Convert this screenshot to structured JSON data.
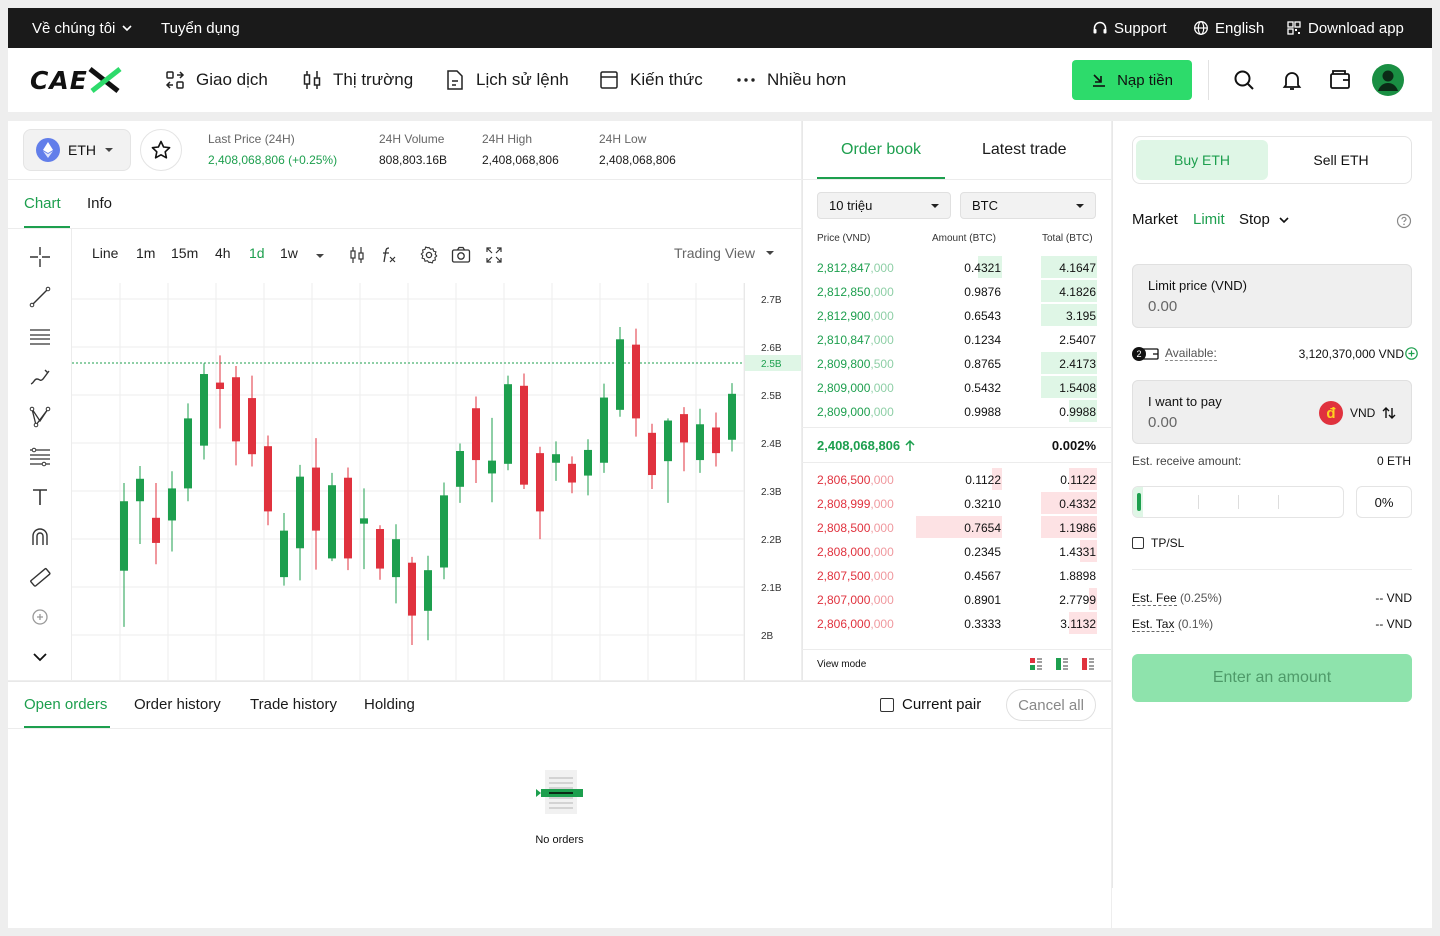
{
  "topbar": {
    "about": "Về chúng tôi",
    "careers": "Tuyển dụng",
    "support": "Support",
    "language": "English",
    "download": "Download app"
  },
  "nav": {
    "logo": "CAEX",
    "items": [
      "Giao dịch",
      "Thị trường",
      "Lịch sử lệnh",
      "Kiến thức",
      "Nhiều hơn"
    ],
    "deposit": "Nạp tiền"
  },
  "market": {
    "pair": "ETH",
    "last_price_label": "Last Price (24H)",
    "last_price": "2,408,068,806 (+0.25%)",
    "volume_label": "24H Volume",
    "volume": "808,803.16B",
    "high_label": "24H High",
    "high": "2,408,068,806",
    "low_label": "24H Low",
    "low": "2,408,068,806"
  },
  "chart_tabs": [
    "Chart",
    "Info"
  ],
  "chart_toolbar": {
    "intervals": [
      "Line",
      "1m",
      "15m",
      "4h",
      "1d",
      "1w"
    ],
    "active_interval": "1d",
    "view": "Trading View"
  },
  "chart_data": {
    "type": "candlestick",
    "y_ticks": [
      "2.7B",
      "2.6B",
      "2.5B",
      "2.5B",
      "2.4B",
      "2.3B",
      "2.2B",
      "2.1B",
      "2B"
    ],
    "current_price_label": "2.5B",
    "candles": [
      {
        "o": 2.212,
        "c": 2.342,
        "h": 2.376,
        "l": 2.107,
        "up": true
      },
      {
        "o": 2.342,
        "c": 2.384,
        "h": 2.408,
        "l": 2.262,
        "up": true
      },
      {
        "o": 2.311,
        "c": 2.264,
        "h": 2.376,
        "l": 2.224,
        "up": false
      },
      {
        "o": 2.306,
        "c": 2.366,
        "h": 2.398,
        "l": 2.248,
        "up": true
      },
      {
        "o": 2.366,
        "c": 2.497,
        "h": 2.525,
        "l": 2.342,
        "up": true
      },
      {
        "o": 2.446,
        "c": 2.58,
        "h": 2.6,
        "l": 2.42,
        "up": true
      },
      {
        "o": 2.564,
        "c": 2.552,
        "h": 2.615,
        "l": 2.478,
        "up": false
      },
      {
        "o": 2.574,
        "c": 2.454,
        "h": 2.595,
        "l": 2.409,
        "up": false
      },
      {
        "o": 2.535,
        "c": 2.43,
        "h": 2.577,
        "l": 2.407,
        "up": false
      },
      {
        "o": 2.445,
        "c": 2.323,
        "h": 2.465,
        "l": 2.297,
        "up": false
      },
      {
        "o": 2.2,
        "c": 2.287,
        "h": 2.32,
        "l": 2.184,
        "up": true
      },
      {
        "o": 2.254,
        "c": 2.388,
        "h": 2.41,
        "l": 2.194,
        "up": true
      },
      {
        "o": 2.405,
        "c": 2.287,
        "h": 2.46,
        "l": 2.214,
        "up": false
      },
      {
        "o": 2.235,
        "c": 2.372,
        "h": 2.395,
        "l": 2.23,
        "up": true
      },
      {
        "o": 2.386,
        "c": 2.235,
        "h": 2.405,
        "l": 2.213,
        "up": false
      },
      {
        "o": 2.31,
        "c": 2.3,
        "h": 2.366,
        "l": 2.215,
        "up": true
      },
      {
        "o": 2.29,
        "c": 2.216,
        "h": 2.297,
        "l": 2.195,
        "up": false
      },
      {
        "o": 2.2,
        "c": 2.271,
        "h": 2.299,
        "l": 2.151,
        "up": true
      },
      {
        "o": 2.227,
        "c": 2.128,
        "h": 2.238,
        "l": 2.073,
        "up": false
      },
      {
        "o": 2.137,
        "c": 2.213,
        "h": 2.24,
        "l": 2.082,
        "up": true
      },
      {
        "o": 2.218,
        "c": 2.353,
        "h": 2.377,
        "l": 2.196,
        "up": true
      },
      {
        "o": 2.369,
        "c": 2.436,
        "h": 2.45,
        "l": 2.339,
        "up": true
      },
      {
        "o": 2.516,
        "c": 2.419,
        "h": 2.538,
        "l": 2.376,
        "up": false
      },
      {
        "o": 2.394,
        "c": 2.418,
        "h": 2.498,
        "l": 2.34,
        "up": true
      },
      {
        "o": 2.412,
        "c": 2.561,
        "h": 2.577,
        "l": 2.4,
        "up": true
      },
      {
        "o": 2.558,
        "c": 2.373,
        "h": 2.581,
        "l": 2.365,
        "up": false
      },
      {
        "o": 2.432,
        "c": 2.323,
        "h": 2.444,
        "l": 2.271,
        "up": false
      },
      {
        "o": 2.414,
        "c": 2.43,
        "h": 2.454,
        "l": 2.38,
        "up": true
      },
      {
        "o": 2.412,
        "c": 2.377,
        "h": 2.426,
        "l": 2.357,
        "up": false
      },
      {
        "o": 2.39,
        "c": 2.438,
        "h": 2.458,
        "l": 2.353,
        "up": true
      },
      {
        "o": 2.414,
        "c": 2.536,
        "h": 2.562,
        "l": 2.395,
        "up": true
      },
      {
        "o": 2.513,
        "c": 2.645,
        "h": 2.668,
        "l": 2.5,
        "up": true
      },
      {
        "o": 2.635,
        "c": 2.497,
        "h": 2.665,
        "l": 2.463,
        "up": false
      },
      {
        "o": 2.47,
        "c": 2.391,
        "h": 2.487,
        "l": 2.365,
        "up": false
      },
      {
        "o": 2.417,
        "c": 2.493,
        "h": 2.497,
        "l": 2.339,
        "up": true
      },
      {
        "o": 2.505,
        "c": 2.452,
        "h": 2.518,
        "l": 2.398,
        "up": false
      },
      {
        "o": 2.419,
        "c": 2.486,
        "h": 2.515,
        "l": 2.395,
        "up": true
      },
      {
        "o": 2.48,
        "c": 2.432,
        "h": 2.508,
        "l": 2.407,
        "up": false
      },
      {
        "o": 2.457,
        "c": 2.543,
        "h": 2.563,
        "l": 2.435,
        "up": true
      }
    ]
  },
  "orderbook": {
    "tabs": [
      "Order book",
      "Latest trade"
    ],
    "group": "10 triệu",
    "quote": "BTC",
    "headers": [
      "Price (VND)",
      "Amount (BTC)",
      "Total (BTC)"
    ],
    "bids": [
      {
        "price": "2,812,847",
        "dim": ",000",
        "amount": "0.4321",
        "total": "4.1647",
        "amt_fill": 0.28,
        "tot_fill": 1.0
      },
      {
        "price": "2,812,850",
        "dim": ",000",
        "amount": "0.9876",
        "total": "4.1826",
        "amt_fill": 0.0,
        "tot_fill": 1.0
      },
      {
        "price": "2,812,900",
        "dim": ",000",
        "amount": "0.6543",
        "total": "3.195",
        "amt_fill": 0.0,
        "tot_fill": 1.0
      },
      {
        "price": "2,810,847",
        "dim": ",000",
        "amount": "0.1234",
        "total": "2.5407",
        "amt_fill": 0.0,
        "tot_fill": 0.0
      },
      {
        "price": "2,809,800",
        "dim": ",500",
        "amount": "0.8765",
        "total": "2.4173",
        "amt_fill": 0.0,
        "tot_fill": 1.0
      },
      {
        "price": "2,809,000",
        "dim": ",000",
        "amount": "0.5432",
        "total": "1.5408",
        "amt_fill": 0.0,
        "tot_fill": 1.0
      },
      {
        "price": "2,809,000",
        "dim": ",000",
        "amount": "0.9988",
        "total": "0.9988",
        "amt_fill": 0.0,
        "tot_fill": 0.5
      }
    ],
    "mid_price": "2,408,068,806",
    "mid_pct": "0.002%",
    "asks": [
      {
        "price": "2,806,500",
        "dim": ",000",
        "amount": "0.1122",
        "total": "0.1122",
        "amt_fill": 0.12,
        "tot_fill": 0.5
      },
      {
        "price": "2,808,999",
        "dim": ",000",
        "amount": "0.3210",
        "total": "0.4332",
        "amt_fill": 0.0,
        "tot_fill": 1.0
      },
      {
        "price": "2,808,500",
        "dim": ",000",
        "amount": "0.7654",
        "total": "1.1986",
        "amt_fill": 1.0,
        "tot_fill": 1.0
      },
      {
        "price": "2,808,000",
        "dim": ",000",
        "amount": "0.2345",
        "total": "1.4331",
        "amt_fill": 0.0,
        "tot_fill": 0.3
      },
      {
        "price": "2,807,500",
        "dim": ",000",
        "amount": "0.4567",
        "total": "1.8898",
        "amt_fill": 0.0,
        "tot_fill": 0.0
      },
      {
        "price": "2,807,000",
        "dim": ",000",
        "amount": "0.8901",
        "total": "2.7799",
        "amt_fill": 0.0,
        "tot_fill": 0.15
      },
      {
        "price": "2,806,000",
        "dim": ",000",
        "amount": "0.3333",
        "total": "3.1132",
        "amt_fill": 0.0,
        "tot_fill": 0.5
      }
    ],
    "view_mode": "View mode"
  },
  "orders": {
    "tabs": [
      "Open orders",
      "Order history",
      "Trade history",
      "Holding"
    ],
    "current_pair": "Current pair",
    "cancel_all": "Cancel all",
    "empty": "No orders"
  },
  "trade": {
    "buy": "Buy ETH",
    "sell": "Sell ETH",
    "types": [
      "Market",
      "Limit",
      "Stop"
    ],
    "limit_label": "Limit price (VND)",
    "limit_value": "0.00",
    "badge": "2",
    "available_label": "Available:",
    "available_value": "3,120,370,000 VND",
    "pay_label": "I want to pay",
    "pay_value": "0.00",
    "pay_currency": "VND",
    "currency_symbol": "đ",
    "receive_label": "Est. receive amount:",
    "receive_value": "0 ETH",
    "percent": "0%",
    "slider_level": 0,
    "tpsl": "TP/SL",
    "fee_label": "Est. Fee",
    "fee_rate": "(0.25%)",
    "fee_value": "-- VND",
    "tax_label": "Est. Tax",
    "tax_rate": "(0.1%)",
    "tax_value": "-- VND",
    "submit": "Enter an amount"
  },
  "colors": {
    "accent": "#1d9f4e",
    "up": "#1d9f4e",
    "down": "#e0323e",
    "deposit_bg": "#2ddb6b",
    "disabled_bg": "#8ee3ac"
  }
}
